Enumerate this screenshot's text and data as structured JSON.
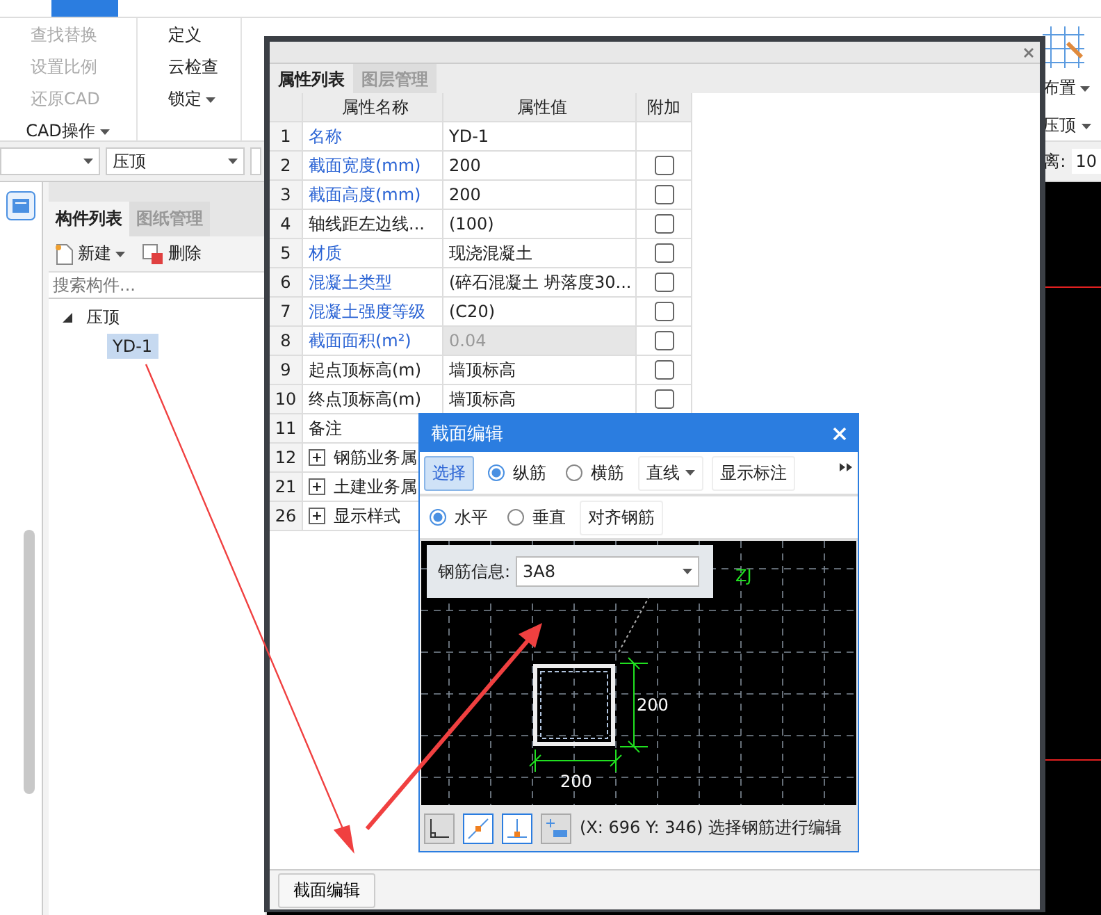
{
  "ribbon": {
    "groups": [
      {
        "label": "CAD操作",
        "items": [
          {
            "label": "查找替换",
            "disabled": true,
            "dropdown": false
          },
          {
            "label": "设置比例",
            "disabled": true,
            "dropdown": false
          },
          {
            "label": "还原CAD",
            "disabled": true,
            "dropdown": false
          }
        ]
      },
      {
        "items": [
          {
            "label": "定义",
            "disabled": false,
            "dropdown": false
          },
          {
            "label": "云检查",
            "disabled": false,
            "dropdown": false
          },
          {
            "label": "锁定",
            "disabled": false,
            "dropdown": true
          }
        ]
      },
      {
        "label": "压顶",
        "items": [
          {
            "label": "布置",
            "disabled": false,
            "dropdown": true
          }
        ]
      }
    ]
  },
  "toolbar": {
    "dropdowns": [
      {
        "value": "压顶"
      }
    ],
    "distance_label": "离:",
    "distance_value": "10"
  },
  "component_panel": {
    "tabs": [
      {
        "label": "构件列表",
        "selected": true
      },
      {
        "label": "图纸管理",
        "selected": false
      }
    ],
    "actions": [
      {
        "label": "新建",
        "dropdown": true
      },
      {
        "label": "删除",
        "dropdown": false
      }
    ],
    "search": {
      "placeholder": "搜索构件..."
    },
    "tree": [
      {
        "label": "压顶",
        "expanded": true,
        "selected": false,
        "children": [
          {
            "label": "YD-1",
            "selected": true
          }
        ]
      }
    ]
  },
  "property_panel": {
    "tabs": [
      {
        "label": "属性列表",
        "selected": true
      },
      {
        "label": "图层管理",
        "selected": false
      }
    ],
    "columns": [
      "属性名称",
      "属性值",
      "附加"
    ],
    "rows": [
      {
        "index": "1",
        "kind": "plain",
        "name": "名称",
        "value": "YD-1",
        "public": true,
        "disabled": false
      },
      {
        "index": "2",
        "kind": "check",
        "name": "截面宽度(mm)",
        "value": "200",
        "public": true,
        "disabled": false,
        "checked": false
      },
      {
        "index": "3",
        "kind": "check",
        "name": "截面高度(mm)",
        "value": "200",
        "public": true,
        "disabled": false,
        "checked": false
      },
      {
        "index": "4",
        "kind": "check",
        "name": "轴线距左边线...",
        "value": "(100)",
        "public": false,
        "disabled": false,
        "checked": false
      },
      {
        "index": "5",
        "kind": "check",
        "name": "材质",
        "value": "现浇混凝土",
        "public": true,
        "disabled": false,
        "checked": false
      },
      {
        "index": "6",
        "kind": "check",
        "name": "混凝土类型",
        "value": "(碎石混凝土 坍落度30...",
        "public": true,
        "disabled": false,
        "checked": false
      },
      {
        "index": "7",
        "kind": "check",
        "name": "混凝土强度等级",
        "value": "(C20)",
        "public": true,
        "disabled": false,
        "checked": false
      },
      {
        "index": "8",
        "kind": "check",
        "name": "截面面积(m²)",
        "value": "0.04",
        "public": true,
        "disabled": true,
        "checked": false
      },
      {
        "index": "9",
        "kind": "check",
        "name": "起点顶标高(m)",
        "value": "墙顶标高",
        "public": false,
        "disabled": false,
        "checked": false
      },
      {
        "index": "10",
        "kind": "check",
        "name": "终点顶标高(m)",
        "value": "墙顶标高",
        "public": false,
        "disabled": false,
        "checked": false
      },
      {
        "index": "11",
        "kind": "plain",
        "name": "备注",
        "public": false
      },
      {
        "index": "12",
        "kind": "group",
        "name": "钢筋业务属",
        "expanded": false
      },
      {
        "index": "21",
        "kind": "group",
        "name": "土建业务属",
        "expanded": false
      },
      {
        "index": "26",
        "kind": "group",
        "name": "显示样式",
        "expanded": false
      }
    ],
    "footer_button": "截面编辑"
  },
  "section_dialog": {
    "title": "截面编辑",
    "toolbar_rows": [
      [
        {
          "kind": "button",
          "label": "选择",
          "selected": true
        },
        {
          "kind": "radio",
          "label": "纵筋",
          "selected": true
        },
        {
          "kind": "radio",
          "label": "横筋",
          "selected": false
        },
        {
          "kind": "dropdown",
          "label": "直线"
        },
        {
          "kind": "button",
          "label": "显示标注",
          "selected": false
        }
      ],
      [
        {
          "kind": "radio",
          "label": "水平",
          "selected": true
        },
        {
          "kind": "radio",
          "label": "垂直",
          "selected": false
        },
        {
          "kind": "button",
          "label": "对齐钢筋",
          "selected": false
        }
      ]
    ],
    "rebar_info": {
      "label": "钢筋信息:",
      "value": "3A8"
    },
    "canvas": {
      "width_dim": "200",
      "height_dim": "200",
      "rebar_code": "ZJ"
    },
    "tools": [
      {
        "kind": "axis",
        "selected": false
      },
      {
        "kind": "line",
        "selected": true
      },
      {
        "kind": "perpendicular",
        "selected": true
      },
      {
        "kind": "add",
        "selected": false
      }
    ],
    "status": "(X: 696 Y: 346) 选择钢筋进行编辑"
  }
}
